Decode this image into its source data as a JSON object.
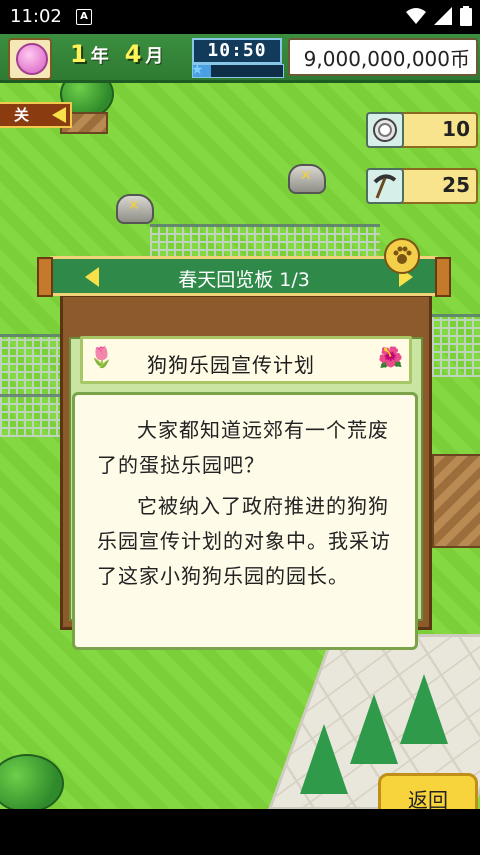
{
  "status_bar": {
    "time": "11:02",
    "app_badge": "A"
  },
  "hud": {
    "year_num": "1",
    "year_unit": "年",
    "month_num": "4",
    "month_unit": "月",
    "clock": "10:50",
    "time_progress": 0.2,
    "money": "9,000,000,000币"
  },
  "close_tab": {
    "label": "关"
  },
  "counters": [
    {
      "icon": "coin-icon",
      "value": "10"
    },
    {
      "icon": "pickaxe-icon",
      "value": "25"
    }
  ],
  "dialog": {
    "title": "春天回览板 1/3",
    "subtitle": "狗狗乐园宣传计划",
    "paragraphs": [
      "大家都知道远郊有一个荒废了的蛋挞乐园吧？",
      "它被纳入了政府推进的狗狗乐园宣传计划的对象中。我采访了这家小狗狗乐园的园长。"
    ]
  },
  "back_button": {
    "label": "返回"
  },
  "colors": {
    "grass": "#7fd63a",
    "banner": "#2f8a4a",
    "button": "#f7d33c"
  }
}
